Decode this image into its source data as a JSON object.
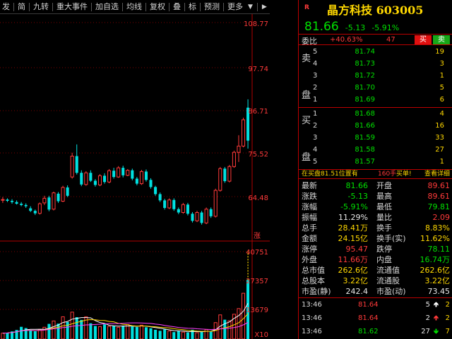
{
  "toolbar": {
    "items": [
      "发",
      "简",
      "九转",
      "重大事件",
      "加自选",
      "均线",
      "复权",
      "叠",
      "标",
      "预测",
      "更多"
    ],
    "more_arrow": "▼",
    "right_arrow": "▶"
  },
  "price_axis": {
    "labels": [
      "108.77",
      "97.74",
      "86.71",
      "75.52",
      "64.48"
    ],
    "zhang_tag": "涨"
  },
  "volume_axis": {
    "labels": [
      "40751",
      "27357",
      "13679"
    ],
    "unit": "X10"
  },
  "header": {
    "badge": "R",
    "title": "晶方科技 603005",
    "price": "81.66",
    "change": "-5.13",
    "change_pct": "-5.91%"
  },
  "weibi": {
    "label": "委比",
    "ratio": "+40.63%",
    "diff": "47",
    "buy_label": "买",
    "sell_label": "卖"
  },
  "order_book": {
    "sell_label": "卖\n盘",
    "buy_label": "买\n盘",
    "sell": [
      {
        "level": "5",
        "price": "81.74",
        "vol": "19"
      },
      {
        "level": "4",
        "price": "81.73",
        "vol": "3"
      },
      {
        "level": "3",
        "price": "81.72",
        "vol": "1"
      },
      {
        "level": "2",
        "price": "81.70",
        "vol": "5"
      },
      {
        "level": "1",
        "price": "81.69",
        "vol": "6"
      }
    ],
    "buy": [
      {
        "level": "1",
        "price": "81.68",
        "vol": "4"
      },
      {
        "level": "2",
        "price": "81.66",
        "vol": "16"
      },
      {
        "level": "3",
        "price": "81.59",
        "vol": "33"
      },
      {
        "level": "4",
        "price": "81.58",
        "vol": "27"
      },
      {
        "level": "5",
        "price": "81.57",
        "vol": "1"
      }
    ]
  },
  "trade_bar": {
    "a": "在买盘81.51位置有",
    "b": "160手",
    "c": "买单!",
    "d": "查看详细"
  },
  "stats": [
    {
      "l1": "最新",
      "v1": "81.66",
      "c1": "green",
      "l2": "开盘",
      "v2": "89.61",
      "c2": "red"
    },
    {
      "l1": "涨跌",
      "v1": "-5.13",
      "c1": "green",
      "l2": "最高",
      "v2": "89.61",
      "c2": "red"
    },
    {
      "l1": "涨幅",
      "v1": "-5.91%",
      "c1": "green",
      "l2": "最低",
      "v2": "79.81",
      "c2": "green"
    },
    {
      "l1": "振幅",
      "v1": "11.29%",
      "c1": "white",
      "l2": "量比",
      "v2": "2.09",
      "c2": "red"
    },
    {
      "l1": "总手",
      "v1": "28.41万",
      "c1": "yellow",
      "l2": "换手",
      "v2": "8.83%",
      "c2": "yellow"
    },
    {
      "l1": "金额",
      "v1": "24.15亿",
      "c1": "yellow",
      "l2": "换手(实)",
      "v2": "11.62%",
      "c2": "yellow"
    },
    {
      "l1": "涨停",
      "v1": "95.47",
      "c1": "red",
      "l2": "跌停",
      "v2": "78.11",
      "c2": "green"
    },
    {
      "l1": "外盘",
      "v1": "11.66万",
      "c1": "red",
      "l2": "内盘",
      "v2": "16.74万",
      "c2": "green"
    },
    {
      "l1": "总市值",
      "v1": "262.6亿",
      "c1": "yellow",
      "l2": "流通值",
      "v2": "262.6亿",
      "c2": "yellow"
    },
    {
      "l1": "总股本",
      "v1": "3.22亿",
      "c1": "yellow",
      "l2": "流通股",
      "v2": "3.22亿",
      "c2": "yellow"
    },
    {
      "l1": "市盈(静)",
      "v1": "242.4",
      "c1": "white",
      "l2": "市盈(动)",
      "v2": "73.45",
      "c2": "white"
    }
  ],
  "ticks": [
    {
      "time": "13:46",
      "price": "81.64",
      "vol": "5",
      "dir": "up",
      "n": "2"
    },
    {
      "time": "13:46",
      "price": "81.64",
      "vol": "2",
      "dir": "up",
      "n": "2"
    },
    {
      "time": "13:46",
      "price": "81.62",
      "vol": "27",
      "dir": "down",
      "n": "7"
    }
  ],
  "colors": {
    "up": "#ff3a3a",
    "down": "#00e0e0",
    "ma5": "#ffffff",
    "ma10": "#ffd800",
    "ma20": "#ff40ff"
  },
  "chart_data": {
    "type": "candlestick",
    "price_range": [
      57.5,
      112
    ],
    "volume_max": 45000,
    "candles": [
      [
        67.5,
        68.2,
        66.8,
        67.6
      ],
      [
        67.6,
        67.9,
        67.0,
        67.3
      ],
      [
        67.3,
        67.7,
        66.6,
        67.0
      ],
      [
        67.0,
        67.4,
        66.4,
        66.6
      ],
      [
        66.6,
        67.0,
        66.0,
        66.3
      ],
      [
        66.3,
        66.7,
        65.6,
        66.0
      ],
      [
        65.5,
        66.0,
        64.6,
        64.9
      ],
      [
        64.9,
        65.2,
        63.9,
        64.3
      ],
      [
        64.3,
        66.9,
        64.0,
        66.6
      ],
      [
        66.8,
        68.5,
        66.3,
        67.9
      ],
      [
        68.1,
        68.5,
        64.8,
        65.2
      ],
      [
        65.3,
        69.5,
        65.0,
        69.2
      ],
      [
        69.0,
        69.4,
        66.8,
        67.2
      ],
      [
        67.2,
        70.9,
        67.0,
        70.5
      ],
      [
        70.5,
        71.0,
        68.2,
        68.5
      ],
      [
        73.0,
        78.8,
        72.6,
        78.0
      ],
      [
        78.0,
        80.8,
        73.6,
        74.0
      ],
      [
        74.0,
        74.6,
        70.8,
        71.2
      ],
      [
        71.2,
        74.4,
        70.9,
        74.0
      ],
      [
        74.0,
        74.6,
        71.8,
        72.1
      ],
      [
        72.1,
        72.5,
        70.7,
        71.1
      ],
      [
        71.1,
        73.7,
        70.8,
        73.3
      ],
      [
        73.3,
        73.9,
        71.4,
        71.8
      ],
      [
        71.8,
        74.9,
        71.5,
        74.5
      ],
      [
        74.5,
        75.2,
        72.6,
        73.0
      ],
      [
        73.0,
        75.6,
        72.8,
        75.2
      ],
      [
        75.2,
        75.7,
        72.9,
        73.4
      ],
      [
        73.4,
        74.9,
        73.2,
        74.6
      ],
      [
        74.6,
        75.0,
        72.2,
        72.6
      ],
      [
        72.6,
        73.0,
        71.0,
        71.4
      ],
      [
        71.4,
        74.7,
        71.1,
        74.3
      ],
      [
        74.3,
        74.8,
        71.9,
        72.3
      ],
      [
        72.3,
        72.7,
        70.2,
        70.6
      ],
      [
        70.6,
        70.9,
        68.5,
        68.9
      ],
      [
        68.9,
        69.3,
        67.0,
        67.4
      ],
      [
        67.4,
        67.8,
        65.2,
        65.6
      ],
      [
        65.6,
        67.9,
        65.3,
        67.5
      ],
      [
        67.5,
        67.9,
        64.9,
        65.3
      ],
      [
        65.3,
        65.7,
        64.1,
        64.5
      ],
      [
        64.5,
        66.8,
        64.2,
        66.4
      ],
      [
        66.4,
        66.8,
        63.8,
        64.2
      ],
      [
        64.2,
        64.6,
        62.1,
        62.5
      ],
      [
        62.5,
        64.9,
        62.2,
        64.5
      ],
      [
        64.5,
        64.9,
        61.6,
        62.0
      ],
      [
        62.0,
        65.7,
        61.7,
        65.3
      ],
      [
        65.3,
        65.7,
        63.2,
        63.6
      ],
      [
        63.6,
        70.2,
        63.3,
        69.8
      ],
      [
        69.8,
        75.4,
        69.5,
        75.0
      ],
      [
        75.0,
        75.4,
        71.6,
        72.0
      ],
      [
        72.0,
        75.9,
        71.7,
        75.5
      ],
      [
        75.5,
        79.3,
        75.2,
        78.9
      ],
      [
        78.9,
        83.0,
        76.6,
        80.4
      ],
      [
        80.4,
        87.2,
        80.1,
        86.7
      ],
      [
        89.6,
        91.6,
        79.8,
        81.7
      ]
    ],
    "volumes": [
      2800,
      3000,
      3600,
      4300,
      5800,
      5200,
      4200,
      3700,
      4500,
      5600,
      7200,
      8600,
      7300,
      10600,
      8100,
      12800,
      10400,
      9100,
      10600,
      7500,
      6200,
      5900,
      7000,
      6000,
      6300,
      5600,
      6100,
      6900,
      6000,
      5700,
      6600,
      5600,
      5100,
      4400,
      3900,
      4600,
      3800,
      3300,
      3800,
      3300,
      3100,
      4400,
      3000,
      3300,
      4500,
      3400,
      7800,
      11500,
      9200,
      8700,
      11800,
      14500,
      21800,
      28100
    ]
  }
}
